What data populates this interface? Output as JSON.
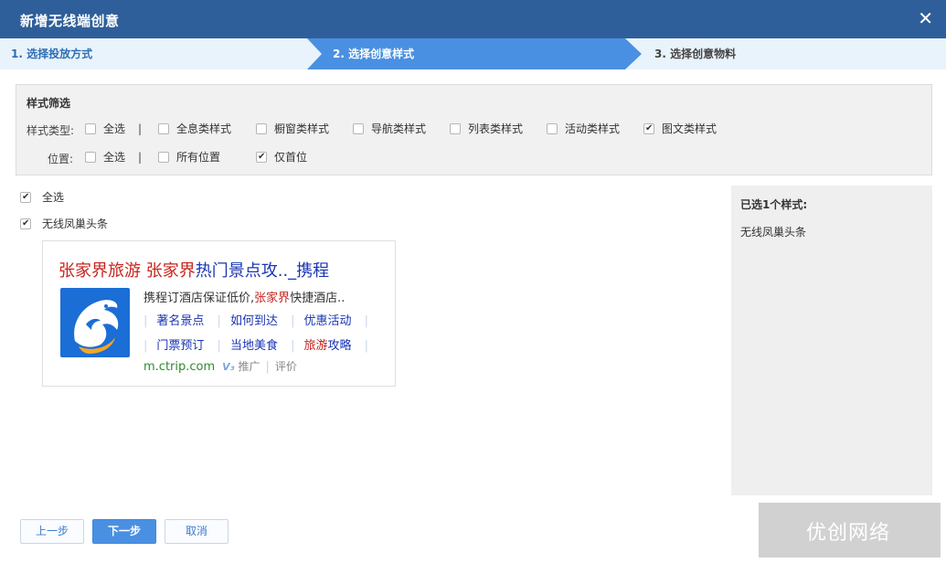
{
  "dialog": {
    "title": "新增无线端创意",
    "close_glyph": "✕"
  },
  "steps": [
    {
      "label": "1. 选择投放方式"
    },
    {
      "label": "2. 选择创意样式",
      "active": true
    },
    {
      "label": "3. 选择创意物料"
    }
  ],
  "filter": {
    "title": "样式筛选",
    "type_label": "样式类型:",
    "type_options": [
      {
        "label": "全选",
        "checked": false
      },
      {
        "label": "全息类样式",
        "checked": false
      },
      {
        "label": "橱窗类样式",
        "checked": false
      },
      {
        "label": "导航类样式",
        "checked": false
      },
      {
        "label": "列表类样式",
        "checked": false
      },
      {
        "label": "活动类样式",
        "checked": false
      },
      {
        "label": "图文类样式",
        "checked": true
      }
    ],
    "position_label": "位置:",
    "position_options": [
      {
        "label": "全选",
        "checked": false
      },
      {
        "label": "所有位置",
        "checked": false
      },
      {
        "label": "仅首位",
        "checked": true
      }
    ],
    "separator": "|"
  },
  "style_list": [
    {
      "label": "全选",
      "checked": true
    },
    {
      "label": "无线凤巢头条",
      "checked": true
    }
  ],
  "preview": {
    "title_parts": [
      "张家界旅游",
      " ",
      "张家界",
      "热门景点攻.._携程"
    ],
    "desc_parts": [
      "携程订酒店保证低价,",
      "张家界",
      "快捷酒店.."
    ],
    "links_row1": [
      "著名景点",
      "如何到达",
      "优惠活动"
    ],
    "links_row2": [
      "门票预订",
      "当地美食",
      "旅游",
      "攻略"
    ],
    "pipe": "|",
    "url": "m.ctrip.com",
    "v_badge": "V₃",
    "ad_label": "推广",
    "comment_label": "评价",
    "logo_color": "#1b6ed5"
  },
  "selected_panel": {
    "title": "已选1个样式:",
    "items": [
      "无线凤巢头条"
    ]
  },
  "buttons": {
    "prev": "上一步",
    "next": "下一步",
    "cancel": "取消"
  },
  "watermark": "优创网络",
  "colors": {
    "titlebar": "#2f5f9a",
    "step_active": "#4a90e2",
    "step_bar": "#e9f3fb",
    "link_blue": "#1a35b3",
    "highlight_red": "#c7241d",
    "url_green": "#2e8b2e"
  }
}
